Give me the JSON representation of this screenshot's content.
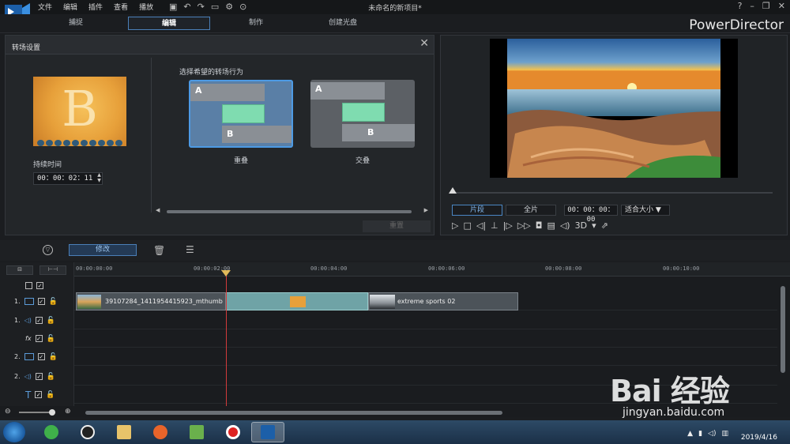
{
  "menu": {
    "items": [
      "文件",
      "编辑",
      "插件",
      "查看",
      "播放"
    ]
  },
  "window": {
    "title": "未命名的新项目*",
    "brand": "PowerDirector",
    "help": "?"
  },
  "modes": [
    {
      "label": "捕捉",
      "active": false
    },
    {
      "label": "编辑",
      "active": true
    },
    {
      "label": "制作",
      "active": false
    },
    {
      "label": "创建光盘",
      "active": false
    }
  ],
  "transition_panel": {
    "title": "转场设置",
    "thumbnail_letter": "B",
    "duration_label": "持续时间",
    "duration_value": "00：00：02：11",
    "choose_label": "选择希望的转场行为",
    "options": [
      {
        "name": "重叠",
        "a": "A",
        "b": "B",
        "selected": true
      },
      {
        "name": "交叠",
        "a": "A",
        "b": "B",
        "selected": false
      }
    ],
    "apply_label": "重置"
  },
  "preview": {
    "segment_clip": "片段",
    "segment_movie": "全片",
    "timecode": "00：00：00：00",
    "fit_label": "适合大小",
    "three_d": "3D"
  },
  "toolbar": {
    "modify_label": "修改"
  },
  "timeline": {
    "ruler": [
      "00:00:00:00",
      "00:00:02:00",
      "00:00:04:00",
      "00:00:06:00",
      "00:00:08:00",
      "00:00:10:00"
    ],
    "tracks": [
      {
        "label": "",
        "type": "master"
      },
      {
        "label": "1.",
        "type": "video"
      },
      {
        "label": "1.",
        "type": "audio"
      },
      {
        "label": "fx",
        "type": "fx"
      },
      {
        "label": "2.",
        "type": "video"
      },
      {
        "label": "2.",
        "type": "audio"
      },
      {
        "label": "T",
        "type": "title"
      }
    ],
    "clips": [
      {
        "name": "39107284_1411954415923_mthumb"
      },
      {
        "name": "extreme sports 02"
      }
    ]
  },
  "taskbar": {
    "clock_date": "2019/4/16"
  },
  "watermark": {
    "text": "Bai 经验",
    "url": "jingyan.baidu.com"
  }
}
